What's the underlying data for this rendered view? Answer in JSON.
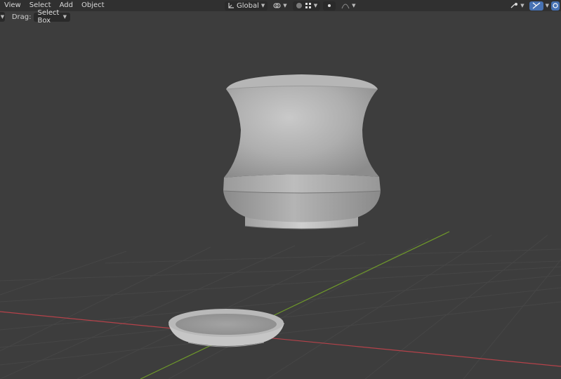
{
  "header": {
    "menu": [
      "View",
      "Select",
      "Add",
      "Object"
    ],
    "transform_orientation": "Global"
  },
  "toolbar": {
    "drag_label": "Drag:",
    "drag_value": "Select Box"
  },
  "icons": {
    "orientation": "transform-orientation-icon",
    "pivot": "pivot-point-icon",
    "snap": "snap-icon",
    "snap_grid": "snap-grid-icon",
    "proportional": "proportional-editing-icon",
    "falloff": "falloff-curve-icon",
    "gizmo": "gizmo-icon",
    "overlay": "overlay-icon",
    "view_toggle": "view-toggle-icon"
  },
  "colors": {
    "axis_x": "#b5424a",
    "axis_y": "#6f9a2a",
    "accent": "#4772b3"
  }
}
